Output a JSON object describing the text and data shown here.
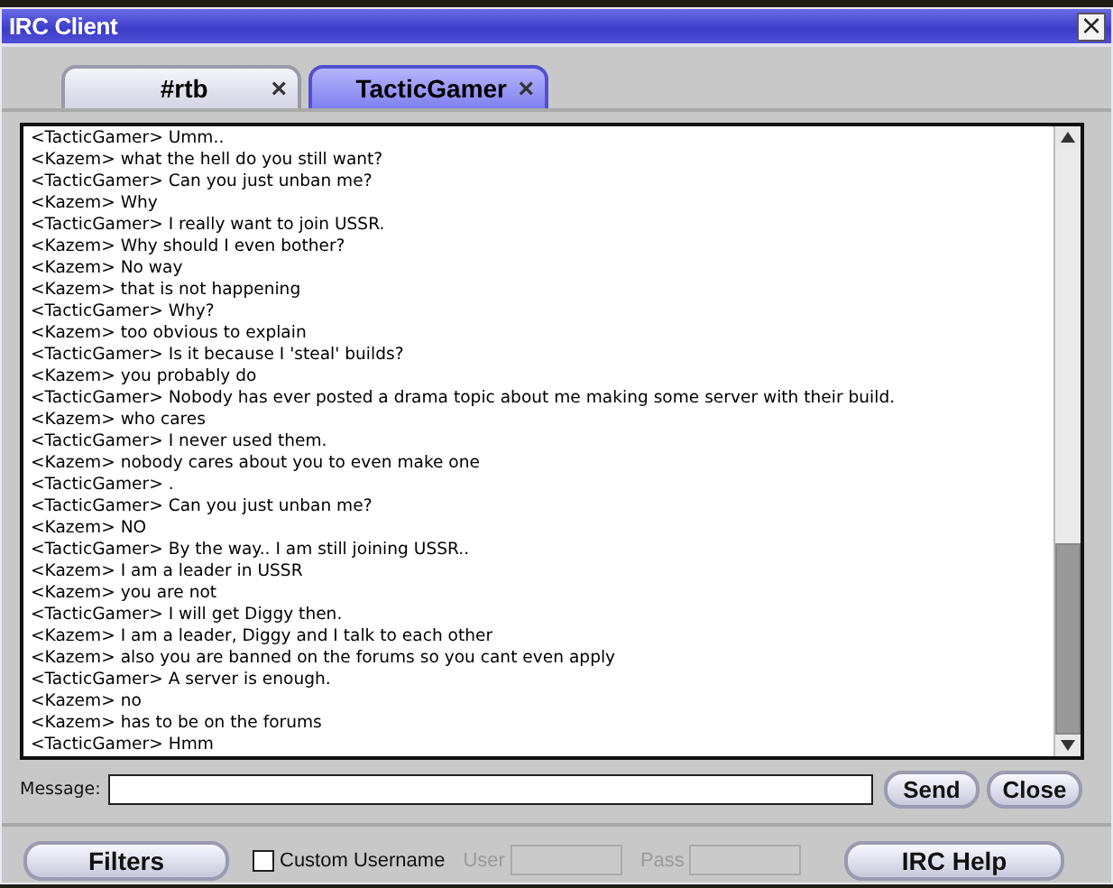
{
  "window": {
    "title": "IRC Client",
    "close": "×"
  },
  "tabs": [
    {
      "label": "#rtb",
      "selected": false,
      "close": "×"
    },
    {
      "label": "TacticGamer",
      "selected": true,
      "close": "×"
    }
  ],
  "messages": [
    "<TacticGamer> Umm..",
    "<Kazem> what the hell do you still want?",
    "<TacticGamer> Can you just unban me?",
    "<Kazem> Why",
    "<TacticGamer> I really want to join USSR.",
    "<Kazem> Why should I even bother?",
    "<Kazem> No way",
    "<Kazem> that is not happening",
    "<TacticGamer> Why?",
    "<Kazem> too obvious to explain",
    "<TacticGamer> Is it because I 'steal' builds?",
    "<Kazem> you probably do",
    "<TacticGamer> Nobody has ever posted a drama topic about me making some server with their build.",
    "<Kazem> who cares",
    "<TacticGamer> I never used them.",
    "<Kazem> nobody cares about you to even make one",
    "<TacticGamer> .",
    "<TacticGamer> Can you just unban me?",
    "<Kazem> NO",
    "<TacticGamer> By the way.. I am still joining USSR..",
    "<Kazem> I am a leader in USSR",
    "<Kazem> you are not",
    "<TacticGamer> I will get Diggy then.",
    "<Kazem> I am a leader, Diggy and I talk to each other",
    "<Kazem> also you are banned on the forums so you cant even apply",
    "<TacticGamer> A server is enough.",
    "<Kazem> no",
    "<Kazem> has to be on the forums",
    "<TacticGamer> Hmm"
  ],
  "message": {
    "label": "Message:",
    "send": "Send",
    "close": "Close"
  },
  "footer": {
    "filters": "Filters",
    "custom_username": {
      "label": "Custom Username",
      "checked": false
    },
    "user": {
      "label": "User",
      "disabled": true
    },
    "pass": {
      "label": "Pass",
      "disabled": true
    },
    "help": "IRC Help"
  }
}
